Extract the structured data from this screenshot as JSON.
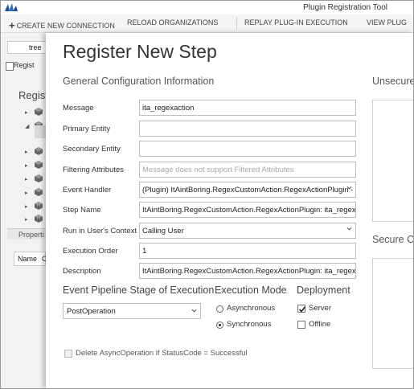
{
  "app": {
    "title": "Plugin Registration Tool",
    "toolbar": {
      "create_connection": "CREATE NEW CONNECTION",
      "reload_orgs": "RELOAD ORGANIZATIONS",
      "replay": "REPLAY PLUG-IN EXECUTION",
      "view": "VIEW PLUG"
    },
    "left_pane": {
      "tab": "tree",
      "register": "Regist",
      "heading": "Registe",
      "properties": "Properti",
      "col_name": "Name",
      "col_other": "C"
    }
  },
  "dialog": {
    "title": "Register New Step",
    "general_header": "General Configuration Information",
    "unsecure_header": "Unsecure",
    "secure_header": "Secure  C",
    "fields": {
      "message": {
        "label": "Message",
        "value": "ita_regexaction"
      },
      "primary_entity": {
        "label": "Primary Entity",
        "value": ""
      },
      "secondary_entity": {
        "label": "Secondary Entity",
        "value": ""
      },
      "filtering_attributes": {
        "label": "Filtering Attributes",
        "placeholder": "Message does not support Filtered Attributes"
      },
      "event_handler": {
        "label": "Event Handler",
        "value": "(Plugin) ItAintBoring.RegexCustomAction.RegexActionPlugin - "
      },
      "step_name": {
        "label": "Step Name",
        "value": "ItAintBoring.RegexCustomAction.RegexActionPlugin: ita_regexaction"
      },
      "run_context": {
        "label": "Run in User's Context",
        "value": "Calling User"
      },
      "execution_order": {
        "label": "Execution Order",
        "value": "1"
      },
      "description": {
        "label": "Description",
        "value": "ItAintBoring.RegexCustomAction.RegexActionPlugin: ita_regexaction"
      }
    },
    "pipeline": {
      "header": "Event Pipeline Stage of Execution",
      "value": "PostOperation"
    },
    "execution_mode": {
      "header": "Execution Mode",
      "async": "Asynchronous",
      "sync": "Synchronous",
      "selected": "Synchronous"
    },
    "deployment": {
      "header": "Deployment",
      "server": "Server",
      "server_checked": true,
      "offline": "Offline",
      "offline_checked": false
    },
    "delete_async": {
      "label": "Delete AsyncOperation if StatusCode = Successful",
      "checked": false,
      "enabled": false
    }
  },
  "colors": {
    "accent": "#1e4e8c",
    "border": "#bdbdbd",
    "placeholder": "#a8a8a8"
  }
}
